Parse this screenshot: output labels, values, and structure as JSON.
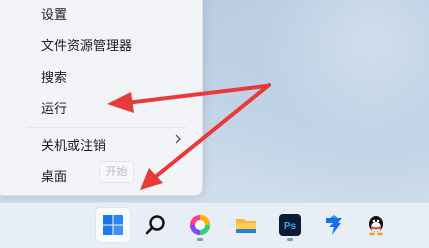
{
  "context_menu": {
    "items": [
      {
        "label": "设置"
      },
      {
        "label": "文件资源管理器"
      },
      {
        "label": "搜索"
      },
      {
        "label": "运行"
      },
      {
        "label": "关机或注销"
      },
      {
        "label": "桌面"
      }
    ]
  },
  "tooltip": {
    "label": "开始"
  },
  "taskbar": {
    "icons": [
      "windows-start-icon",
      "search-icon",
      "color-wheel-app-icon",
      "file-explorer-icon",
      "photoshop-icon",
      "lark-app-icon",
      "qq-icon"
    ],
    "photoshop_label": "Ps"
  },
  "colors": {
    "arrow": "#e8393b",
    "start_blue": "#1a73e8",
    "taskbar_bg": "#e7eef6"
  }
}
